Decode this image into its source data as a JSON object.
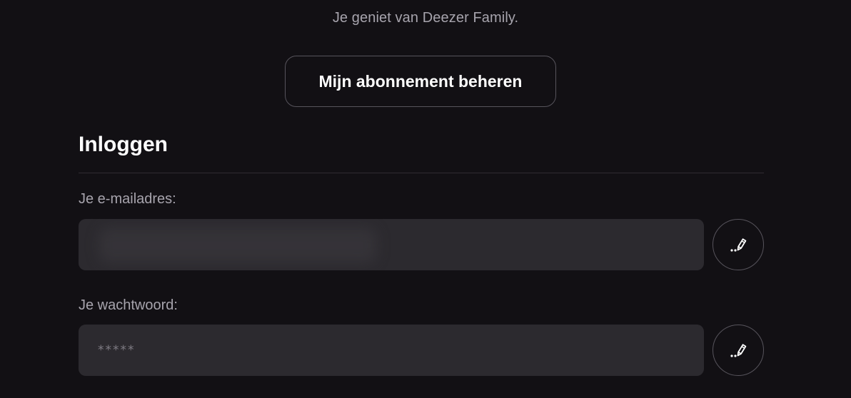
{
  "subscription": {
    "plan_text": "Je geniet van Deezer Family.",
    "manage_label": "Mijn abonnement beheren"
  },
  "login": {
    "title": "Inloggen",
    "email": {
      "label": "Je e-mailadres:",
      "value": ""
    },
    "password": {
      "label": "Je wachtwoord:",
      "value": "*****"
    }
  },
  "icons": {
    "edit": "pencil-edit-icon"
  },
  "colors": {
    "background": "#121014",
    "field_background": "#2c2a2f",
    "muted_text": "#a7a4ad",
    "border": "#57545c"
  }
}
